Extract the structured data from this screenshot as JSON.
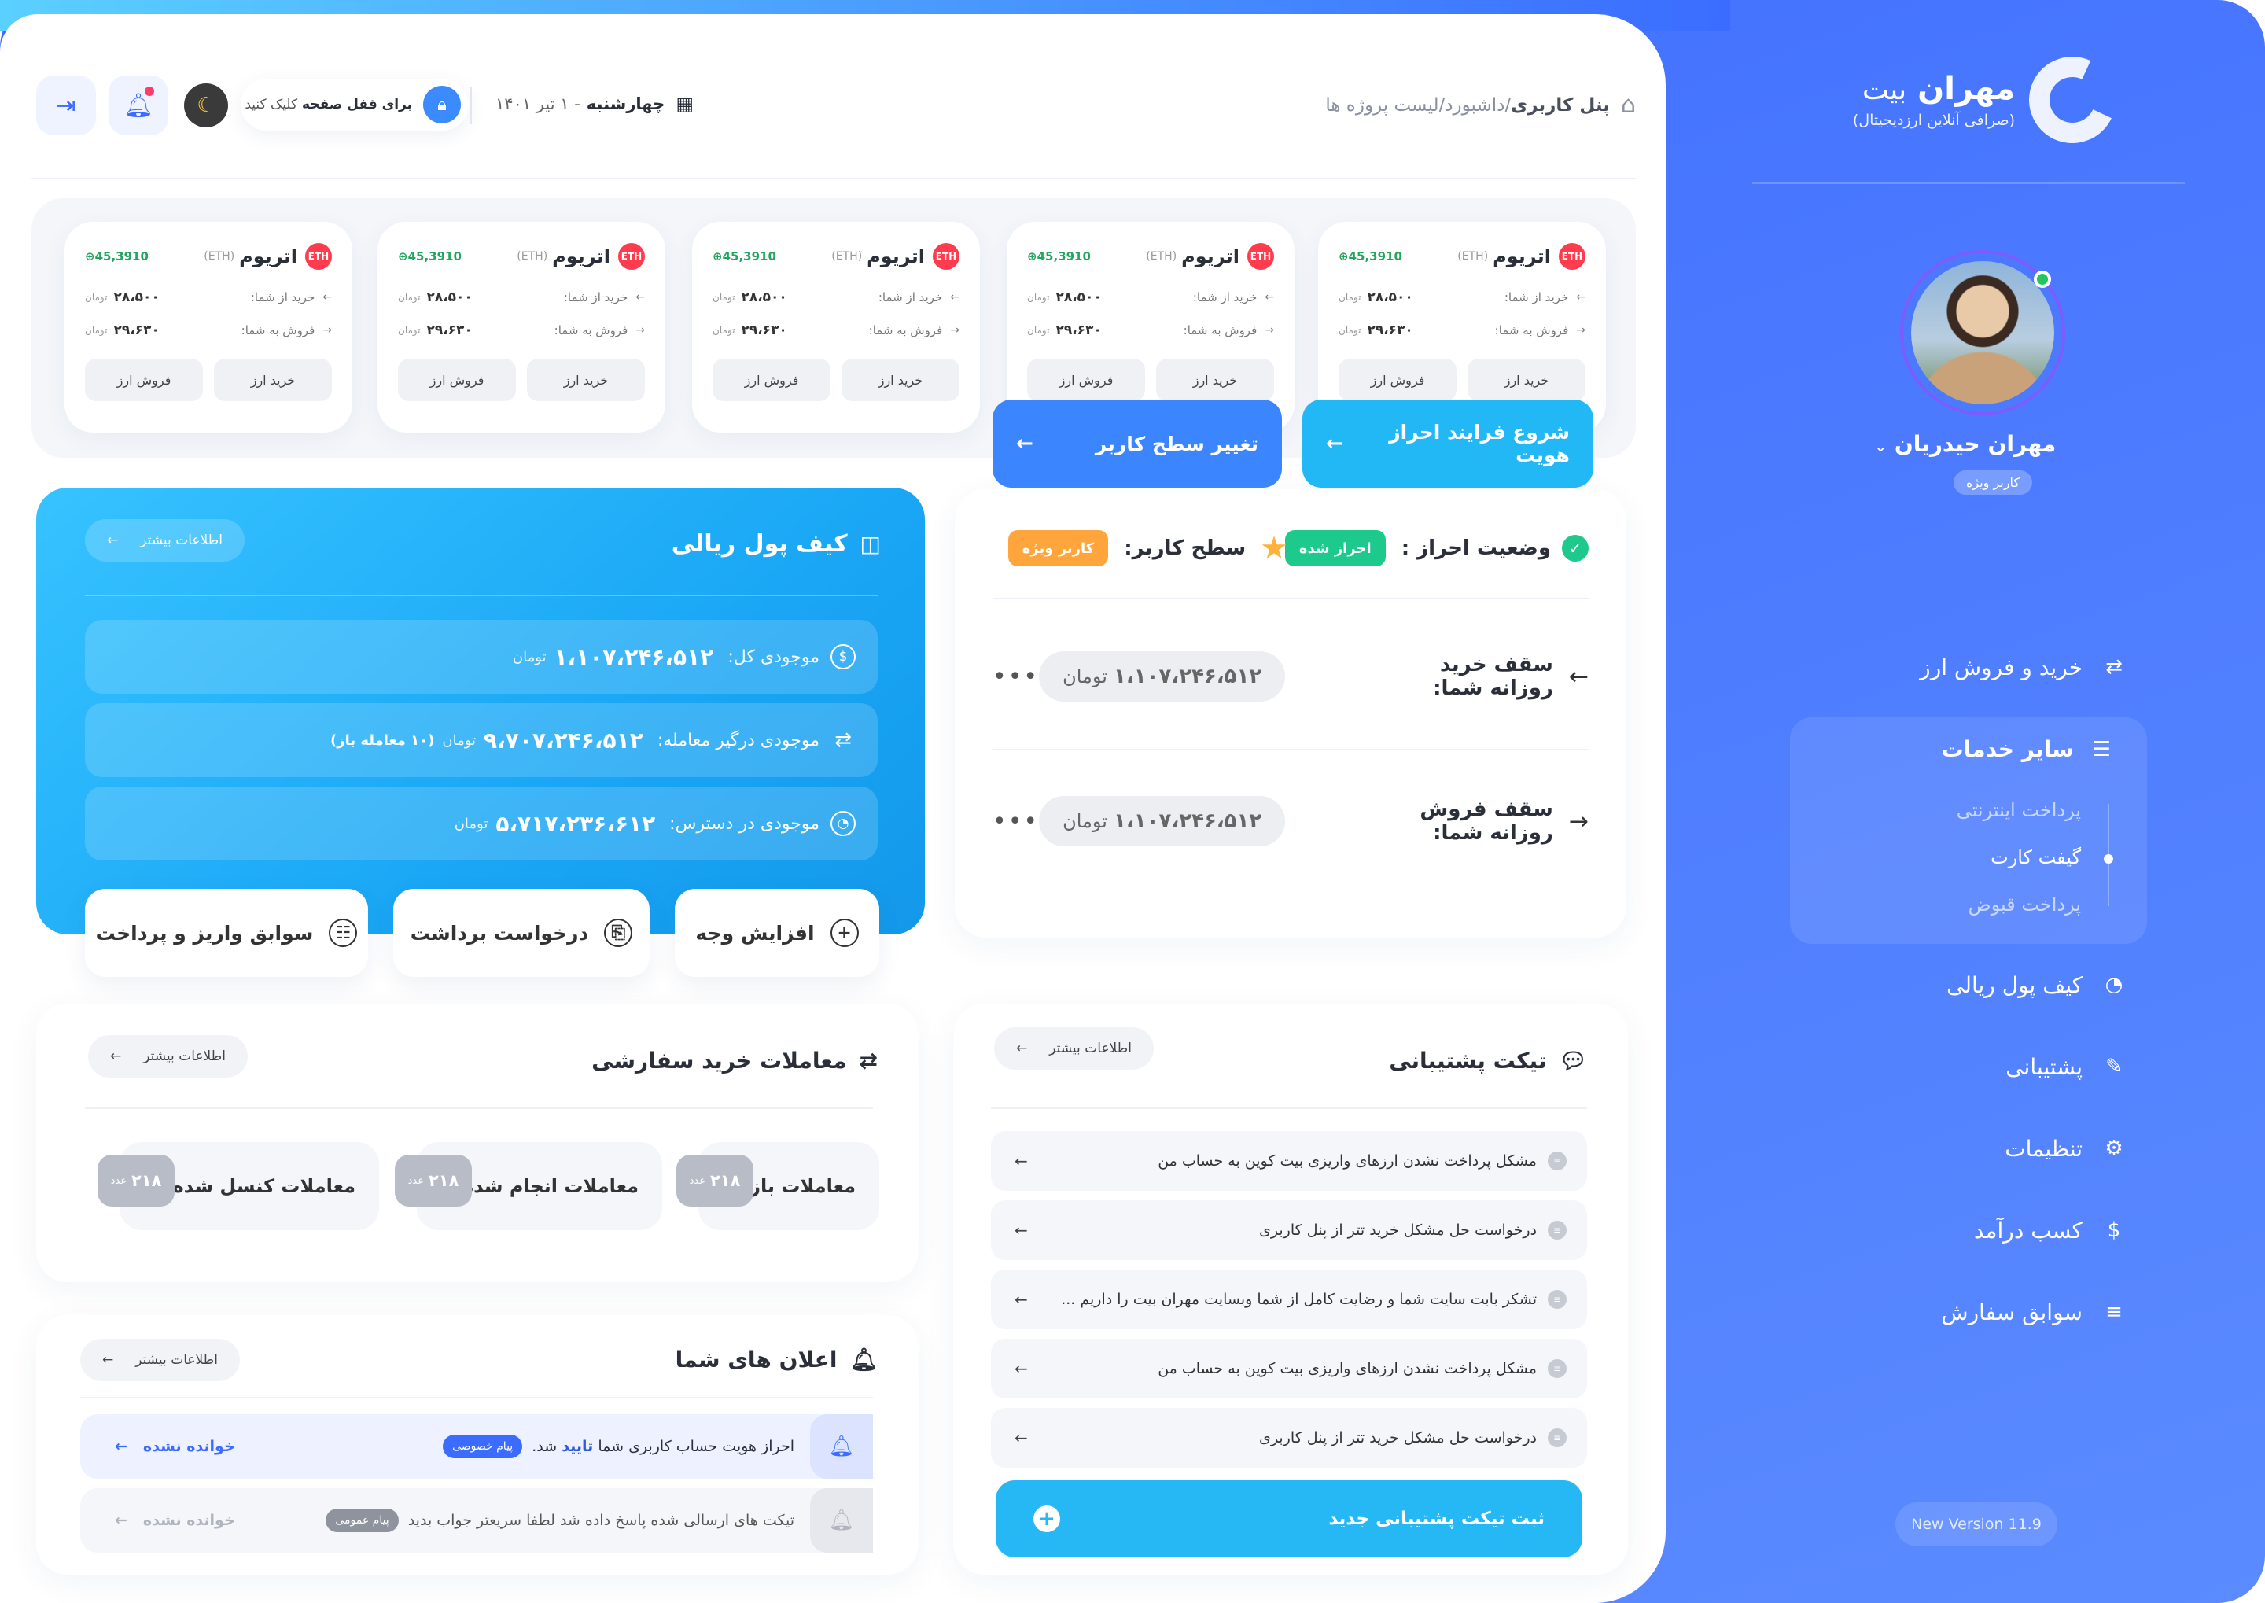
{
  "sidebar": {
    "brand_name_1": "مهران",
    "brand_name_2": "بیت",
    "brand_sub": "(صرافی آنلاین ارزدیجیتال)",
    "user_name": "مهران حیدریان",
    "user_badge": "کاربر ویژه",
    "menu": {
      "trade": "خرید و فروش ارز",
      "services": "سایر خدمات",
      "services_sub": [
        "پرداخت اینترنتی",
        "گیفت کارت",
        "پرداخت قبوض"
      ],
      "wallet": "کیف پول ریالی",
      "support": "پشتیبانی",
      "settings": "تنظیمات",
      "income": "کسب درآمد",
      "orders": "سوابق سفارش"
    },
    "version": "New Version 11.9"
  },
  "header": {
    "breadcrumb_root": "پنل کاربری",
    "breadcrumb_rest": "/داشبورد/لیست پروژه ها",
    "date_day": "چهارشنبه",
    "date_rest": "- ۱ تیر ۱۴۰۱",
    "lock_bold": "برای قفل صفحه",
    "lock_rest": "کلیک کنید"
  },
  "coins": [
    {
      "name": "اتریوم",
      "symbol": "(ETH)",
      "price": "45,3910",
      "buy_label": "خرید از شما:",
      "buy_value": "۲۸،۵۰۰",
      "sell_label": "فروش به شما:",
      "sell_value": "۲۹،۶۳۰",
      "unit": "تومان",
      "btn_buy": "خرید ارز",
      "btn_sell": "فروش ارز"
    },
    {
      "name": "اتریوم",
      "symbol": "(ETH)",
      "price": "45,3910",
      "buy_label": "خرید از شما:",
      "buy_value": "۲۸،۵۰۰",
      "sell_label": "فروش به شما:",
      "sell_value": "۲۹،۶۳۰",
      "unit": "تومان",
      "btn_buy": "خرید ارز",
      "btn_sell": "فروش ارز"
    },
    {
      "name": "اتریوم",
      "symbol": "(ETH)",
      "price": "45,3910",
      "buy_label": "خرید از شما:",
      "buy_value": "۲۸،۵۰۰",
      "sell_label": "فروش به شما:",
      "sell_value": "۲۹،۶۳۰",
      "unit": "تومان",
      "btn_buy": "خرید ارز",
      "btn_sell": "فروش ارز"
    },
    {
      "name": "اتریوم",
      "symbol": "(ETH)",
      "price": "45,3910",
      "buy_label": "خرید از شما:",
      "buy_value": "۲۸،۵۰۰",
      "sell_label": "فروش به شما:",
      "sell_value": "۲۹،۶۳۰",
      "unit": "تومان",
      "btn_buy": "خرید ارز",
      "btn_sell": "فروش ارز"
    },
    {
      "name": "اتریوم",
      "symbol": "(ETH)",
      "price": "45,3910",
      "buy_label": "خرید از شما:",
      "buy_value": "۲۸،۵۰۰",
      "sell_label": "فروش به شما:",
      "sell_value": "۲۹،۶۳۰",
      "unit": "تومان",
      "btn_buy": "خرید ارز",
      "btn_sell": "فروش ارز"
    }
  ],
  "wallet": {
    "title": "کیف پول ریالی",
    "more": "اطلاعات بیشتر",
    "rows": [
      {
        "label": "موجودی کل:",
        "amount": "۱،۱۰۷،۲۴۶،۵۱۲",
        "unit": "تومان",
        "extra": ""
      },
      {
        "label": "موجودی درگیر معامله:",
        "amount": "۹،۷۰۷،۲۴۶،۵۱۲",
        "unit": "تومان",
        "extra": "(۱۰ معامله باز)"
      },
      {
        "label": "موجودی در دسترس:",
        "amount": "۵،۷۱۷،۲۳۶،۶۱۲",
        "unit": "تومان",
        "extra": ""
      }
    ],
    "btn_deposit": "افزایش وجه",
    "btn_withdraw": "درخواست برداشت",
    "btn_history": "سوابق واریز و پرداخت"
  },
  "verify": {
    "status_label": "وضعیت احراز :",
    "status_badge": "احراز شده",
    "level_label": "سطح کاربر:",
    "level_badge": "کاربر ویژه",
    "buy_limit_label": "سقف خرید روزانه شما:",
    "buy_limit_value": "۱،۱۰۷،۲۴۶،۵۱۲",
    "sell_limit_label": "سقف فروش روزانه شما:",
    "sell_limit_value": "۱،۱۰۷،۲۴۶،۵۱۲",
    "unit": "تومان",
    "btn_kyc": "شروع فرایند احراز هویت",
    "btn_level": "تغییر سطح کاربر",
    "colors": {
      "verified": "#1ec98c",
      "level": "#ffb13c"
    }
  },
  "orders": {
    "title": "معاملات خرید سفارشی",
    "more": "اطلاعات بیشتر",
    "items": [
      {
        "label": "معاملات باز:",
        "count": "۲۱۸",
        "unit": "عدد"
      },
      {
        "label": "معاملات انجام شده:",
        "count": "۲۱۸",
        "unit": "عدد"
      },
      {
        "label": "معاملات کنسل شده:",
        "count": "۲۱۸",
        "unit": "عدد"
      }
    ]
  },
  "notifications": {
    "title": "اعلان های شما",
    "more": "اطلاعات بیشتر",
    "items": [
      {
        "text_a": "احراز هویت حساب کاربری شما",
        "text_b": "تایید",
        "text_c": "شد.",
        "tag": "پیام خصوصی",
        "status": "خوانده نشده"
      },
      {
        "text_a": "تیکت های ارسالی شده پاسخ داده شد لطفا سریعتر جواب بدید",
        "text_b": "",
        "text_c": "",
        "tag": "پیام عمومی",
        "status": "خوانده نشده"
      }
    ]
  },
  "tickets": {
    "title": "تیکت پشتیبانی",
    "more": "اطلاعات بیشتر",
    "items": [
      "مشکل پرداخت نشدن ارزهای واریزی بیت کوین به حساب من",
      "درخواست حل مشکل خرید تتر از پنل کاربری",
      "تشکر بابت سایت شما و رضایت کامل از شما وبسایت مهران بیت را داریم ...",
      "مشکل پرداخت نشدن ارزهای واریزی بیت کوین به حساب من",
      "درخواست حل مشکل خرید تتر از پنل کاربری"
    ],
    "btn_new": "ثبت تیکت پشتیبانی جدید"
  }
}
